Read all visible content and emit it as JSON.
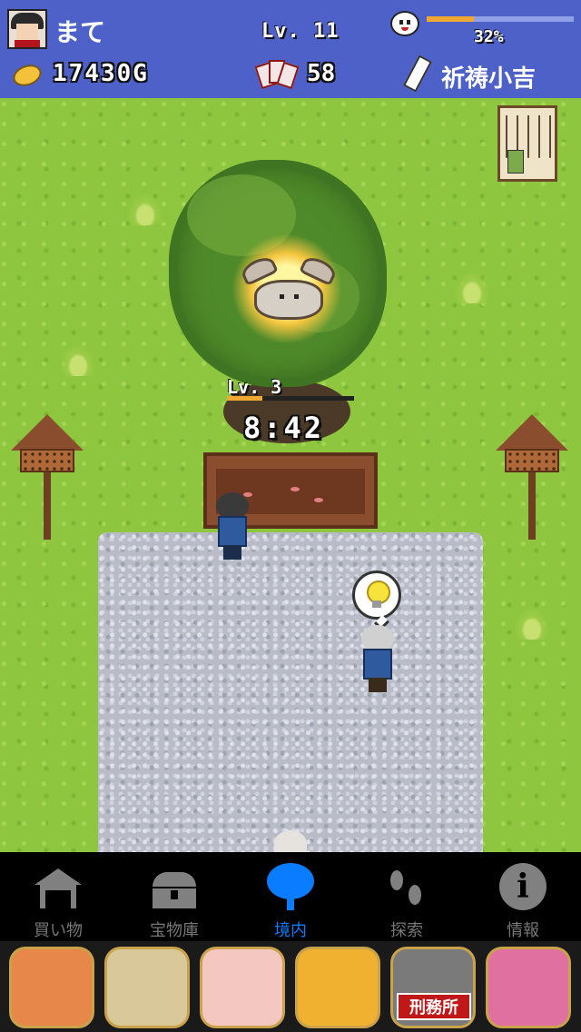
{
  "player": {
    "name": "まて",
    "level": "Lv. 11",
    "exp_percent_label": "32%",
    "exp_fraction": 0.32
  },
  "resources": {
    "gold": "17430G",
    "cards": "58",
    "fortune": "祈祷小吉"
  },
  "scene": {
    "tree_level": "Lv. 3",
    "tree_progress_fraction": 0.28,
    "timer": "8:42"
  },
  "icons": {
    "avatar": "player-avatar-icon",
    "mood": "smiley-face-icon",
    "coin": "gold-coin-icon",
    "cards": "hanafuda-cards-icon",
    "omikuji": "omikuji-slip-icon",
    "lightbulb": "lightbulb-icon"
  },
  "tabs": [
    {
      "label": "買い物",
      "icon": "shrine-icon",
      "active": false
    },
    {
      "label": "宝物庫",
      "icon": "treasure-chest-icon",
      "active": false
    },
    {
      "label": "境内",
      "icon": "tree-icon",
      "active": true
    },
    {
      "label": "探索",
      "icon": "footprints-icon",
      "active": false
    },
    {
      "label": "情報",
      "icon": "info-icon",
      "active": false
    }
  ],
  "ads": [
    {
      "label": "",
      "bg": "#e8874a"
    },
    {
      "label": "",
      "bg": "#d8c89a"
    },
    {
      "label": "",
      "bg": "#f4c8c0"
    },
    {
      "label": "",
      "bg": "#f0b030"
    },
    {
      "label": "刑務所",
      "bg": "#7a7a7a"
    },
    {
      "label": "",
      "bg": "#e070a0"
    }
  ],
  "colors": {
    "header": "#4d61c8",
    "accent": "#0a7cff",
    "exp_fill": "#f0a830",
    "grass": "#8ec63f"
  }
}
